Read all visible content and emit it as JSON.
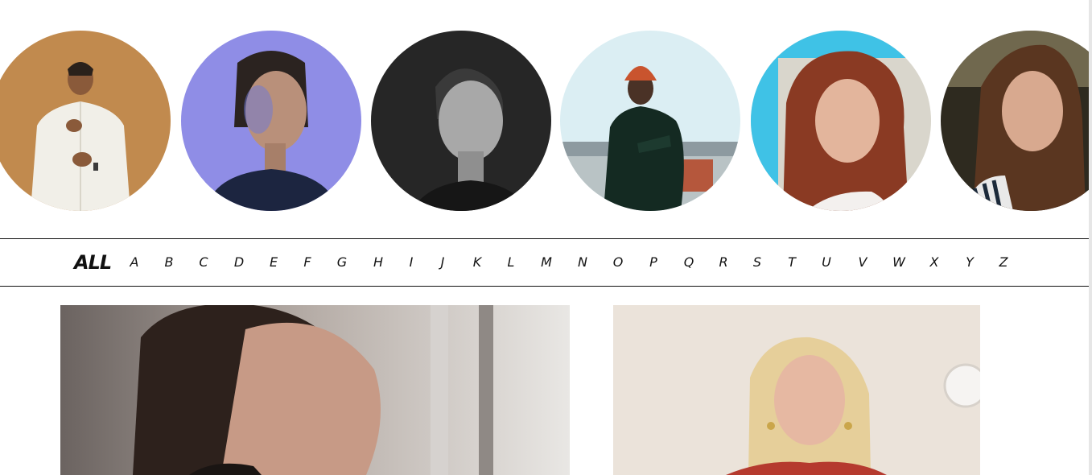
{
  "avatars": [
    {
      "name": "avatar-man-white-kandura",
      "bg": "#c18a4e"
    },
    {
      "name": "avatar-woman-blue-light",
      "bg": "#8f8de6"
    },
    {
      "name": "avatar-woman-monochrome",
      "bg": "#262626"
    },
    {
      "name": "avatar-man-orange-beanie",
      "bg": "#dbeef3"
    },
    {
      "name": "avatar-woman-red-hair",
      "bg": "#3fc2e6"
    },
    {
      "name": "avatar-woman-brown-hair",
      "bg": "#2e2a1f"
    }
  ],
  "alphabet": {
    "all_label": "ALL",
    "letters": [
      "A",
      "B",
      "C",
      "D",
      "E",
      "F",
      "G",
      "H",
      "I",
      "J",
      "K",
      "L",
      "M",
      "N",
      "O",
      "P",
      "Q",
      "R",
      "S",
      "T",
      "U",
      "V",
      "W",
      "X",
      "Y",
      "Z"
    ]
  },
  "cards": [
    {
      "name": "card-photo-woman-profile"
    },
    {
      "name": "card-photo-woman-blonde"
    }
  ]
}
